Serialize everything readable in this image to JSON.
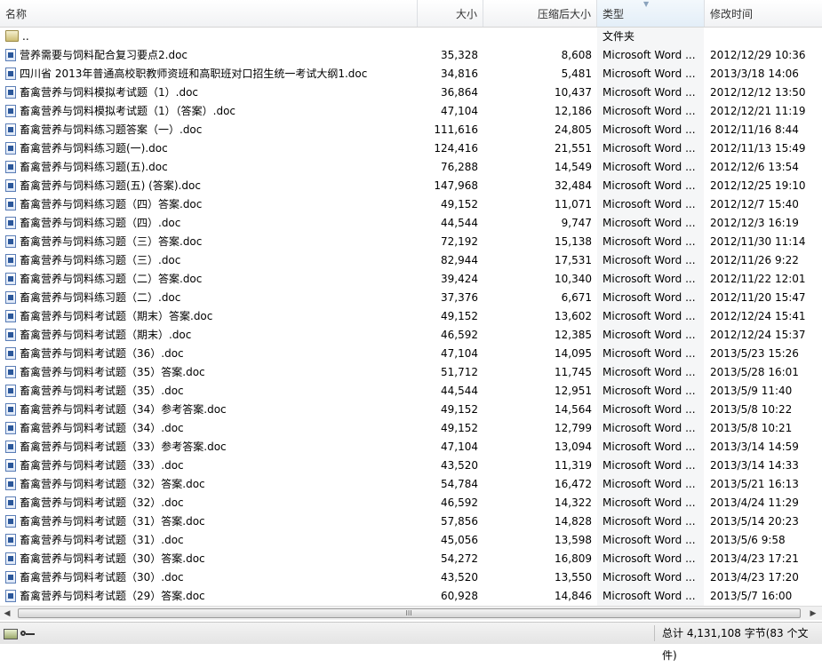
{
  "columns": {
    "name": "名称",
    "size": "大小",
    "compressed": "压缩后大小",
    "type": "类型",
    "modified": "修改时间"
  },
  "parent_row": {
    "name": "..",
    "type": "文件夹"
  },
  "files": [
    {
      "name": "营养需要与饲料配合复习要点2.doc",
      "size": "35,328",
      "compressed": "8,608",
      "type": "Microsoft Word ...",
      "modified": "2012/12/29 10:36"
    },
    {
      "name": "四川省 2013年普通高校职教师资班和高职班对口招生统一考试大纲1.doc",
      "size": "34,816",
      "compressed": "5,481",
      "type": "Microsoft Word ...",
      "modified": "2013/3/18 14:06"
    },
    {
      "name": "畜禽营养与饲料模拟考试题（1）.doc",
      "size": "36,864",
      "compressed": "10,437",
      "type": "Microsoft Word ...",
      "modified": "2012/12/12 13:50"
    },
    {
      "name": "畜禽营养与饲料模拟考试题（1）（答案）.doc",
      "size": "47,104",
      "compressed": "12,186",
      "type": "Microsoft Word ...",
      "modified": "2012/12/21 11:19"
    },
    {
      "name": "畜禽营养与饲料练习题答案（一）.doc",
      "size": "111,616",
      "compressed": "24,805",
      "type": "Microsoft Word ...",
      "modified": "2012/11/16 8:44"
    },
    {
      "name": "畜禽营养与饲料练习题(一).doc",
      "size": "124,416",
      "compressed": "21,551",
      "type": "Microsoft Word ...",
      "modified": "2012/11/13 15:49"
    },
    {
      "name": "畜禽营养与饲料练习题(五).doc",
      "size": "76,288",
      "compressed": "14,549",
      "type": "Microsoft Word ...",
      "modified": "2012/12/6 13:54"
    },
    {
      "name": "畜禽营养与饲料练习题(五) (答案).doc",
      "size": "147,968",
      "compressed": "32,484",
      "type": "Microsoft Word ...",
      "modified": "2012/12/25 19:10"
    },
    {
      "name": "畜禽营养与饲料练习题（四）答案.doc",
      "size": "49,152",
      "compressed": "11,071",
      "type": "Microsoft Word ...",
      "modified": "2012/12/7 15:40"
    },
    {
      "name": "畜禽营养与饲料练习题（四）.doc",
      "size": "44,544",
      "compressed": "9,747",
      "type": "Microsoft Word ...",
      "modified": "2012/12/3 16:19"
    },
    {
      "name": "畜禽营养与饲料练习题（三）答案.doc",
      "size": "72,192",
      "compressed": "15,138",
      "type": "Microsoft Word ...",
      "modified": "2012/11/30 11:14"
    },
    {
      "name": "畜禽营养与饲料练习题（三）.doc",
      "size": "82,944",
      "compressed": "17,531",
      "type": "Microsoft Word ...",
      "modified": "2012/11/26 9:22"
    },
    {
      "name": "畜禽营养与饲料练习题（二）答案.doc",
      "size": "39,424",
      "compressed": "10,340",
      "type": "Microsoft Word ...",
      "modified": "2012/11/22 12:01"
    },
    {
      "name": "畜禽营养与饲料练习题（二）.doc",
      "size": "37,376",
      "compressed": "6,671",
      "type": "Microsoft Word ...",
      "modified": "2012/11/20 15:47"
    },
    {
      "name": "畜禽营养与饲料考试题（期末）答案.doc",
      "size": "49,152",
      "compressed": "13,602",
      "type": "Microsoft Word ...",
      "modified": "2012/12/24 15:41"
    },
    {
      "name": "畜禽营养与饲料考试题（期末）.doc",
      "size": "46,592",
      "compressed": "12,385",
      "type": "Microsoft Word ...",
      "modified": "2012/12/24 15:37"
    },
    {
      "name": "畜禽营养与饲料考试题（36）.doc",
      "size": "47,104",
      "compressed": "14,095",
      "type": "Microsoft Word ...",
      "modified": "2013/5/23 15:26"
    },
    {
      "name": "畜禽营养与饲料考试题（35）答案.doc",
      "size": "51,712",
      "compressed": "11,745",
      "type": "Microsoft Word ...",
      "modified": "2013/5/28 16:01"
    },
    {
      "name": "畜禽营养与饲料考试题（35）.doc",
      "size": "44,544",
      "compressed": "12,951",
      "type": "Microsoft Word ...",
      "modified": "2013/5/9 11:40"
    },
    {
      "name": "畜禽营养与饲料考试题（34）参考答案.doc",
      "size": "49,152",
      "compressed": "14,564",
      "type": "Microsoft Word ...",
      "modified": "2013/5/8 10:22"
    },
    {
      "name": "畜禽营养与饲料考试题（34）.doc",
      "size": "49,152",
      "compressed": "12,799",
      "type": "Microsoft Word ...",
      "modified": "2013/5/8 10:21"
    },
    {
      "name": "畜禽营养与饲料考试题（33）参考答案.doc",
      "size": "47,104",
      "compressed": "13,094",
      "type": "Microsoft Word ...",
      "modified": "2013/3/14 14:59"
    },
    {
      "name": "畜禽营养与饲料考试题（33）.doc",
      "size": "43,520",
      "compressed": "11,319",
      "type": "Microsoft Word ...",
      "modified": "2013/3/14 14:33"
    },
    {
      "name": "畜禽营养与饲料考试题（32）答案.doc",
      "size": "54,784",
      "compressed": "16,472",
      "type": "Microsoft Word ...",
      "modified": "2013/5/21 16:13"
    },
    {
      "name": "畜禽营养与饲料考试题（32）.doc",
      "size": "46,592",
      "compressed": "14,322",
      "type": "Microsoft Word ...",
      "modified": "2013/4/24 11:29"
    },
    {
      "name": "畜禽营养与饲料考试题（31）答案.doc",
      "size": "57,856",
      "compressed": "14,828",
      "type": "Microsoft Word ...",
      "modified": "2013/5/14 20:23"
    },
    {
      "name": "畜禽营养与饲料考试题（31）.doc",
      "size": "45,056",
      "compressed": "13,598",
      "type": "Microsoft Word ...",
      "modified": "2013/5/6 9:58"
    },
    {
      "name": "畜禽营养与饲料考试题（30）答案.doc",
      "size": "54,272",
      "compressed": "16,809",
      "type": "Microsoft Word ...",
      "modified": "2013/4/23 17:21"
    },
    {
      "name": "畜禽营养与饲料考试题（30）.doc",
      "size": "43,520",
      "compressed": "13,550",
      "type": "Microsoft Word ...",
      "modified": "2013/4/23 17:20"
    },
    {
      "name": "畜禽营养与饲料考试题（29）答案.doc",
      "size": "60,928",
      "compressed": "14,846",
      "type": "Microsoft Word ...",
      "modified": "2013/5/7 16:00"
    }
  ],
  "scrollbar": {
    "grip": "III"
  },
  "status": {
    "summary": "总计 4,131,108 字节(83 个文件)"
  },
  "icons": {
    "folder": "folder-icon",
    "word_doc": "word-doc-icon",
    "drive": "drive-icon",
    "key": "key-icon"
  }
}
